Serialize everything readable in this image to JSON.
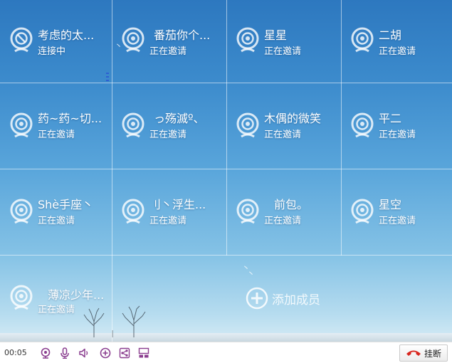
{
  "participants": [
    {
      "name": "考虑的太...",
      "status": "连接中",
      "icon": "blocked-camera-icon"
    },
    {
      "name": "番茄你个...",
      "status": "正在邀请",
      "icon": "camera-icon"
    },
    {
      "name": "星星",
      "status": "正在邀请",
      "icon": "camera-icon"
    },
    {
      "name": "二胡",
      "status": "正在邀请",
      "icon": "camera-icon"
    },
    {
      "name": "药~药~切...",
      "status": "正在邀请",
      "icon": "camera-icon"
    },
    {
      "name": "っ殇滅º、",
      "status": "正在邀请",
      "icon": "camera-icon"
    },
    {
      "name": "木偶的微笑",
      "status": "正在邀请",
      "icon": "camera-icon"
    },
    {
      "name": "平二",
      "status": "正在邀请",
      "icon": "camera-icon"
    },
    {
      "name": "Shè手座丶",
      "status": "正在邀请",
      "icon": "camera-icon"
    },
    {
      "name": "刂丶浮生...",
      "status": "正在邀请",
      "icon": "camera-icon"
    },
    {
      "name": "前包。",
      "status": "正在邀请",
      "icon": "camera-icon"
    },
    {
      "name": "星空",
      "status": "正在邀请",
      "icon": "camera-icon"
    },
    {
      "name": "薄凉少年...",
      "status": "正在邀请",
      "icon": "camera-icon"
    }
  ],
  "add_member": {
    "label": "添加成员",
    "icon": "add-circle-icon"
  },
  "toolbar": {
    "timer": "00:05",
    "icons": [
      "webcam-icon",
      "microphone-icon",
      "speaker-icon",
      "add-circle-icon",
      "share-icon",
      "layout-icon"
    ],
    "hangup_label": "挂断",
    "hangup_icon": "phone-hangup-icon",
    "icon_color": "#8a3d8f",
    "hangup_color": "#d8261e"
  }
}
